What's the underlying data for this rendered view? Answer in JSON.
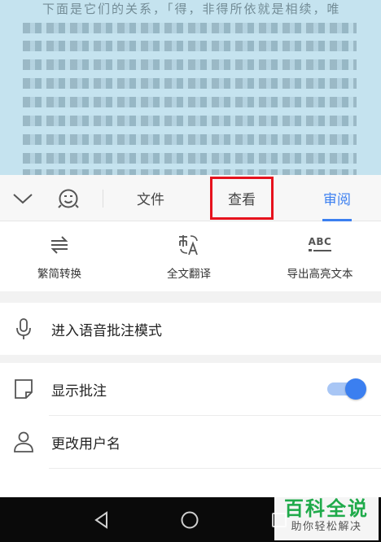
{
  "document": {
    "first_line_fragment": "下面是它们的关系，「得，非得所依就是相续，唯"
  },
  "tabbar": {
    "tabs": [
      {
        "label": "文件",
        "active": false
      },
      {
        "label": "查看",
        "active": false,
        "highlighted": true
      },
      {
        "label": "审阅",
        "active": true
      }
    ]
  },
  "tools": [
    {
      "label": "繁简转换",
      "icon": "traditional-simplified-convert-icon"
    },
    {
      "label": "全文翻译",
      "icon": "translate-icon"
    },
    {
      "label": "导出高亮文本",
      "icon": "export-highlight-text-icon",
      "icon_text": "ABC"
    }
  ],
  "menu": {
    "voice_annotation": {
      "label": "进入语音批注模式",
      "icon": "microphone-icon"
    },
    "show_annotations": {
      "label": "显示批注",
      "icon": "note-icon",
      "toggle_on": true
    },
    "change_username": {
      "label": "更改用户名",
      "icon": "user-icon"
    }
  },
  "watermark": {
    "title": "百科全说",
    "subtitle": "助你轻松解决"
  },
  "colors": {
    "accent": "#3b7ff0",
    "highlight_box": "#e6121d",
    "watermark_green": "#1faa4a"
  }
}
